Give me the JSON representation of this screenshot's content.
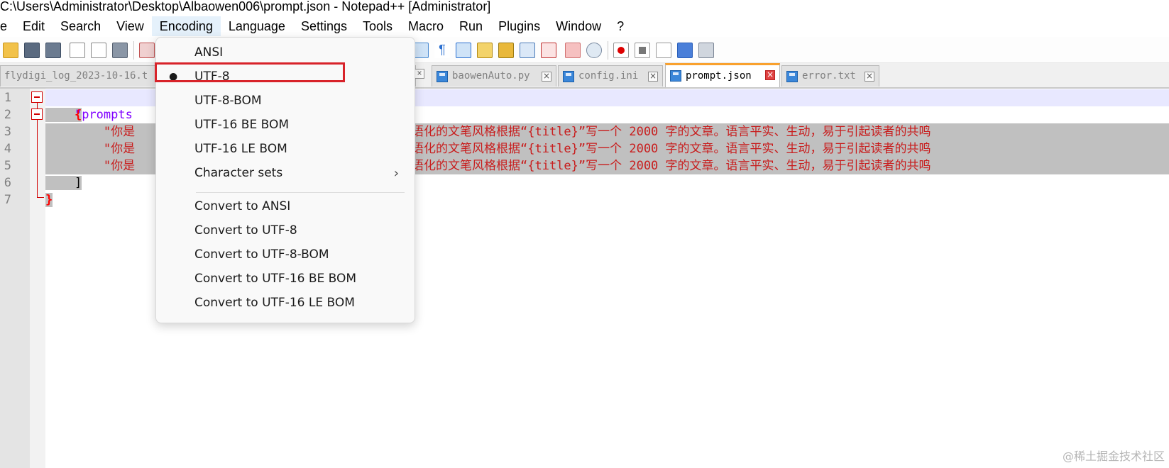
{
  "window": {
    "title": "C:\\Users\\Administrator\\Desktop\\Albaowen006\\prompt.json - Notepad++ [Administrator]"
  },
  "menubar": {
    "items": [
      "e",
      "Edit",
      "Search",
      "View",
      "Encoding",
      "Language",
      "Settings",
      "Tools",
      "Macro",
      "Run",
      "Plugins",
      "Window",
      "?"
    ]
  },
  "tabs": [
    {
      "label": "flydigi_log_2023-10-16.t"
    },
    {
      "label": "baowenAuto.py"
    },
    {
      "label": "config.ini"
    },
    {
      "label": "prompt.json"
    },
    {
      "label": "error.txt"
    }
  ],
  "editor": {
    "line_numbers": [
      "1",
      "2",
      "3",
      "4",
      "5",
      "6",
      "7"
    ],
    "line1": "{",
    "line2_indent": "    ",
    "line2_key": "\"prompts",
    "line3": "        \"你是",
    "line3_rest": "语化的文笔风格根据“{title}”写一个 2000 字的文章。语言平实、生动，易于引起读者的共鸣",
    "line4": "        \"你是",
    "line4_rest": "语化的文笔风格根据“{title}”写一个 2000 字的文章。语言平实、生动，易于引起读者的共鸣",
    "line5": "        \"你是",
    "line5_rest": "语化的文笔风格根据“{title}”写一个 2000 字的文章。语言平实、生动，易于引起读者的共鸣",
    "line6": "    ]",
    "line7": "}"
  },
  "encoding_menu": {
    "items": [
      {
        "label": "ANSI"
      },
      {
        "label": "UTF-8",
        "checked": true
      },
      {
        "label": "UTF-8-BOM"
      },
      {
        "label": "UTF-16 BE BOM"
      },
      {
        "label": "UTF-16 LE BOM"
      },
      {
        "label": "Character sets",
        "submenu": true
      },
      {
        "label": "Convert to ANSI"
      },
      {
        "label": "Convert to UTF-8"
      },
      {
        "label": "Convert to UTF-8-BOM"
      },
      {
        "label": "Convert to UTF-16 BE BOM"
      },
      {
        "label": "Convert to UTF-16 LE BOM"
      }
    ],
    "bullet": "●",
    "arrow": "›"
  },
  "watermark": "@稀土掘金技术社区",
  "colors": {
    "highlight_box": "#d8232a",
    "active_tab_accent": "#f9a12e",
    "selection": "#c0c0c0",
    "string": "#c81e1e",
    "key": "#8000ff"
  }
}
